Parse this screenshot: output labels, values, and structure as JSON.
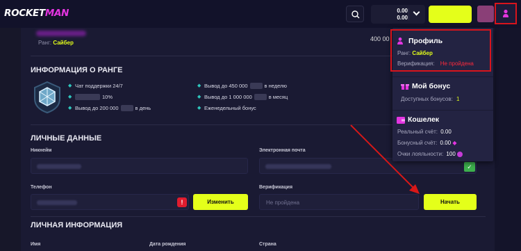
{
  "header": {
    "logo_a": "ROCKET",
    "logo_b": "MAN",
    "balance_real": "0.00",
    "balance_bonus": "0.00"
  },
  "profile_card": {
    "rank_label": "Ранг:",
    "rank_value": "Сайбер",
    "top_balance": "400 00"
  },
  "rank_info": {
    "title": "ИНФОРМАЦИЯ О РАНГЕ",
    "features_col1": [
      "Чат поддержки 24/7",
      "10%",
      "Вывод до 200 000",
      "в день"
    ],
    "features_col2": [
      "Вывод до 450 000",
      "в неделю",
      "Вывод до 1 000 000",
      "в месяц",
      "Еженедельный бонус"
    ]
  },
  "personal_data": {
    "title": "ЛИЧНЫЕ ДАННЫЕ",
    "nickname_label": "Никнейм",
    "email_label": "Электронная почта",
    "phone_label": "Телефон",
    "change_button": "Изменить",
    "verification_label": "Верификация",
    "verification_value": "Не пройдена",
    "start_button": "Начать",
    "warn_symbol": "!",
    "ok_symbol": "✓"
  },
  "personal_info": {
    "title": "ЛИЧНАЯ ИНФОРМАЦИЯ",
    "name_label": "Имя",
    "birth_label": "Дата рождения",
    "country_label": "Страна"
  },
  "dropdown": {
    "profile_title": "Профиль",
    "rank_label": "Ранг:",
    "rank_value": "Сайбер",
    "verification_label": "Верификация:",
    "verification_value": "Не пройдена",
    "bonus_title": "Мой бонус",
    "available_bonuses_label": "Доступных бонусов:",
    "available_bonuses_value": "1",
    "wallet_title": "Кошелек",
    "real_account_label": "Реальный счёт:",
    "real_account_value": "0.00",
    "bonus_account_label": "Бонусный счёт:",
    "bonus_account_value": "0.00",
    "loyalty_label": "Очки лояльности:",
    "loyalty_value": "100"
  },
  "colors": {
    "accent": "#e4ff1a",
    "brand": "#e335e0",
    "alert": "#d8141c",
    "success": "#3db04d",
    "teal": "#2ec6bd"
  }
}
